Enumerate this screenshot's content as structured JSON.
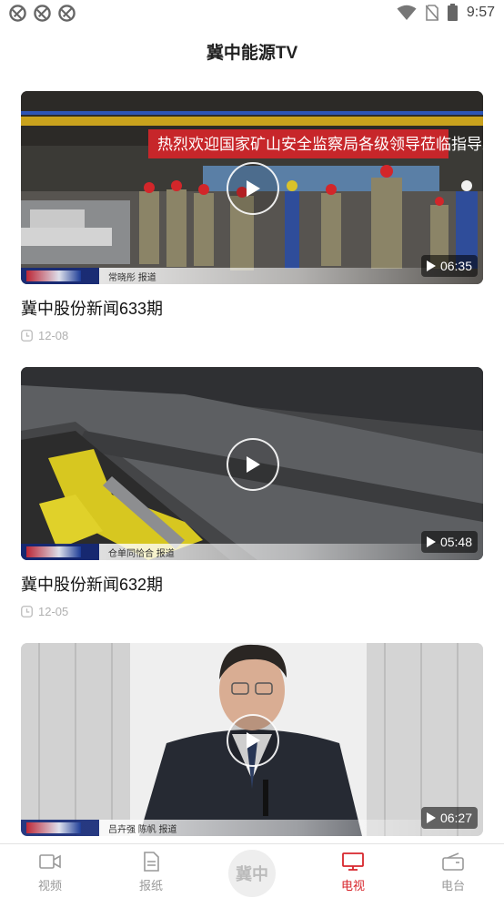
{
  "status_bar": {
    "time": "9:57",
    "left_icons": [
      "notification-icon",
      "notification-icon",
      "notification-icon"
    ],
    "right_icons": [
      "wifi-icon",
      "no-sim-icon",
      "battery-icon"
    ]
  },
  "header": {
    "title": "冀中能源TV"
  },
  "videos": [
    {
      "title": "冀中股份新闻633期",
      "date": "12-08",
      "duration": "06:35",
      "banner_text": "热烈欢迎国家矿山安全监察局各级领导莅临指导工作",
      "credit": "常晓彤 报道"
    },
    {
      "title": "冀中股份新闻632期",
      "date": "12-05",
      "duration": "05:48",
      "credit": "仓单同恰合 报道"
    },
    {
      "title": "",
      "date": "",
      "duration": "06:27",
      "credit": "吕卉强 陈帆 报道"
    }
  ],
  "tabs": [
    {
      "label": "视频",
      "icon": "video-camera-icon",
      "active": false
    },
    {
      "label": "报纸",
      "icon": "newspaper-icon",
      "active": false
    },
    {
      "label": "冀中",
      "icon": "center-logo",
      "active": false
    },
    {
      "label": "电视",
      "icon": "tv-monitor-icon",
      "active": true
    },
    {
      "label": "电台",
      "icon": "radio-icon",
      "active": false
    }
  ],
  "colors": {
    "accent": "#d7262c",
    "inactive": "#999999",
    "meta": "#b0b0b0"
  }
}
